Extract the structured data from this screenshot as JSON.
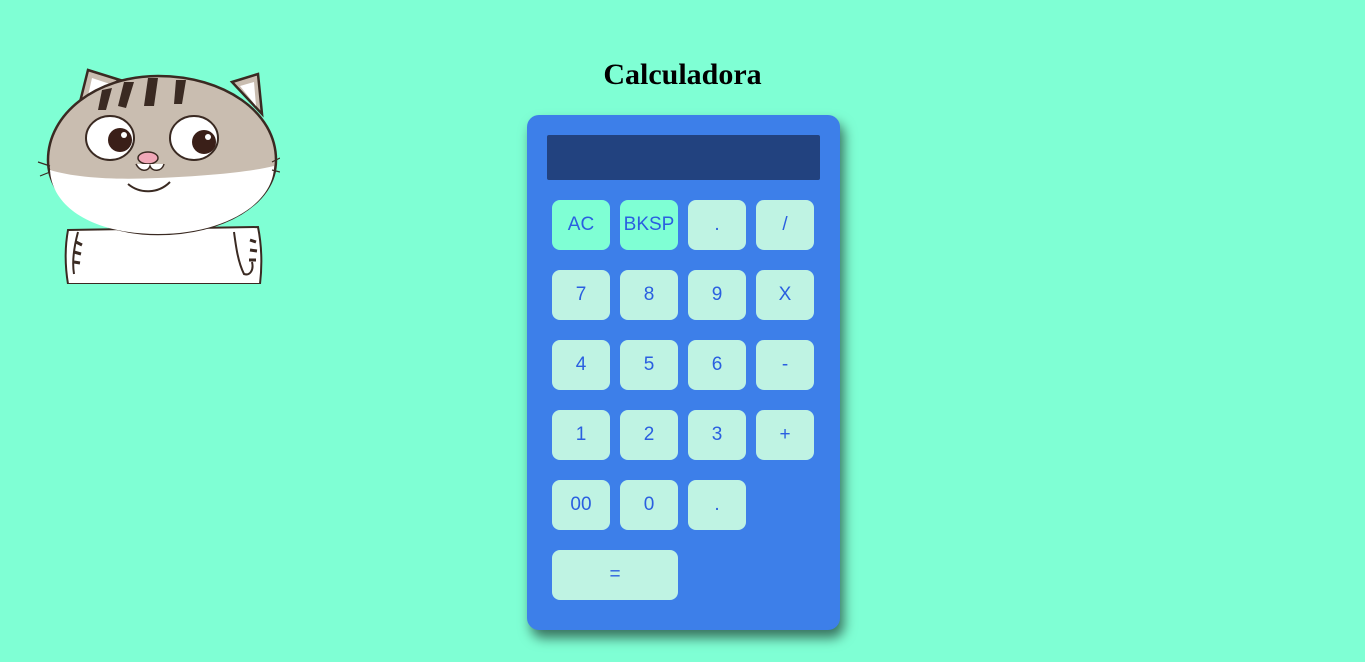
{
  "page": {
    "title": "Calculadora",
    "background": "#7fffd4"
  },
  "mascot": {
    "icon": "cat-icon"
  },
  "calculator": {
    "display_value": "",
    "body_color": "#3d7fe9",
    "display_color": "#22427f",
    "button_color": "#bff3e3",
    "accent_button_color": "#7fffd4",
    "button_text_color": "#2a5fe0",
    "buttons": {
      "clear": "AC",
      "backspace": "BKSP",
      "dot_top": ".",
      "divide": "/",
      "seven": "7",
      "eight": "8",
      "nine": "9",
      "multiply": "X",
      "four": "4",
      "five": "5",
      "six": "6",
      "minus": "-",
      "one": "1",
      "two": "2",
      "three": "3",
      "plus": "+",
      "double_zero": "00",
      "zero": "0",
      "dot_bottom": ".",
      "equals": "="
    }
  }
}
